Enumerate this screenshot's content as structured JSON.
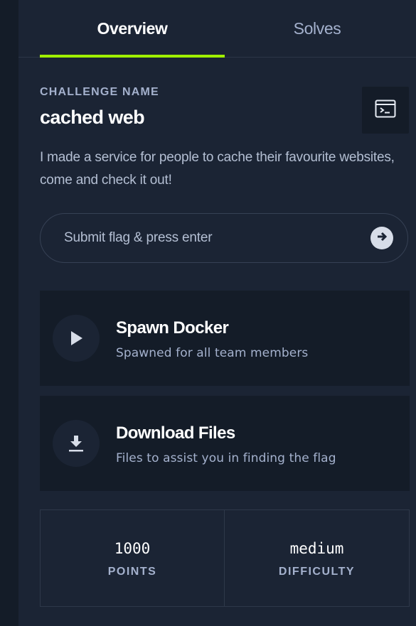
{
  "tabs": [
    {
      "label": "Overview",
      "active": true
    },
    {
      "label": "Solves",
      "active": false
    }
  ],
  "challenge": {
    "eyebrow": "CHALLENGE NAME",
    "name": "cached web",
    "description": "I made a service for people to cache their favourite websites, come and check it out!"
  },
  "terminal_button": {
    "icon": "terminal-icon"
  },
  "flag": {
    "placeholder": "Submit flag & press enter",
    "value": "",
    "submit_icon": "arrow-right-circle-icon"
  },
  "actions": [
    {
      "title": "Spawn Docker",
      "subtitle": "Spawned for all team members",
      "icon": "play-icon"
    },
    {
      "title": "Download Files",
      "subtitle": "Files to assist you in finding the flag",
      "icon": "download-icon"
    }
  ],
  "stats": {
    "points": {
      "value": "1000",
      "label": "POINTS"
    },
    "difficulty": {
      "value": "medium",
      "label": "DIFFICULTY"
    }
  },
  "colors": {
    "accent": "#9fef00",
    "panel_bg": "#1b2434",
    "card_bg": "#141c28",
    "muted_text": "#a4b1cd"
  }
}
